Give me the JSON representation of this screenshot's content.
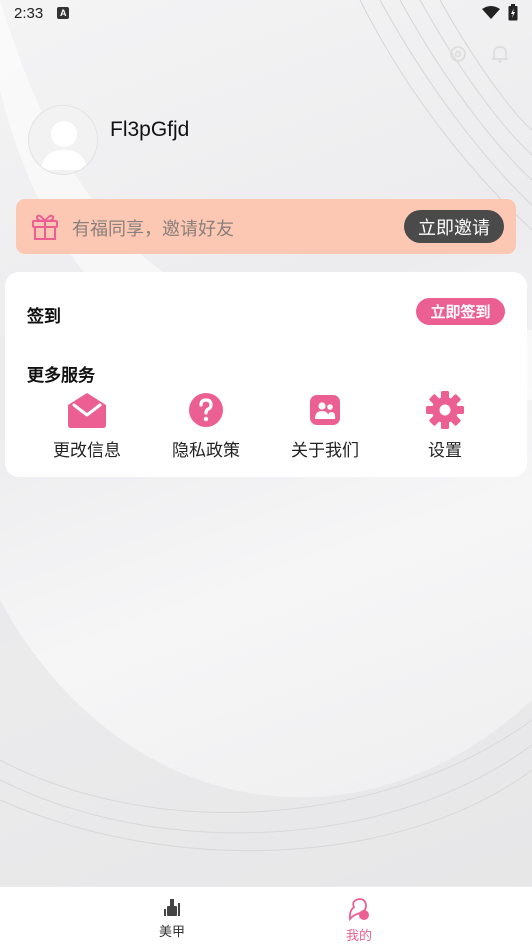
{
  "status_bar": {
    "time": "2:33",
    "notification_badge": "A"
  },
  "profile": {
    "username": "Fl3pGfjd"
  },
  "invite": {
    "text": "有福同享，邀请好友",
    "button_label": "立即邀请"
  },
  "checkin": {
    "label": "签到",
    "button_label": "立即签到"
  },
  "services": {
    "title": "更多服务",
    "items": [
      {
        "label": "更改信息",
        "icon": "envelope-icon"
      },
      {
        "label": "隐私政策",
        "icon": "question-icon"
      },
      {
        "label": "关于我们",
        "icon": "people-icon"
      },
      {
        "label": "设置",
        "icon": "gear-icon"
      }
    ]
  },
  "bottom_nav": {
    "items": [
      {
        "label": "美甲",
        "icon": "nail-polish-icon",
        "active": false
      },
      {
        "label": "我的",
        "icon": "profile-icon",
        "active": true
      }
    ]
  },
  "colors": {
    "accent": "#ec5f93",
    "invite_bg": "#fdc8b3",
    "invite_button": "#4a4a4a",
    "inactive_nav": "#333333"
  }
}
